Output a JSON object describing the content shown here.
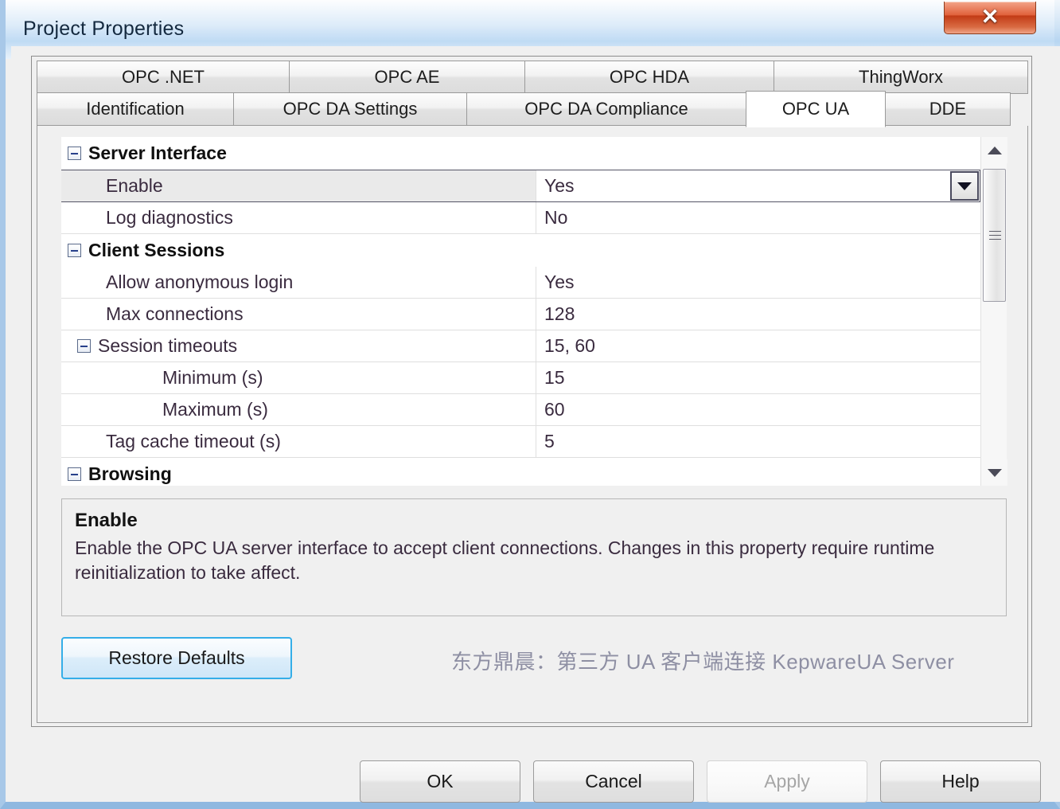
{
  "window": {
    "title": "Project Properties",
    "close_label": "✕"
  },
  "tabs": {
    "row1": [
      {
        "label": "OPC .NET",
        "selected": false
      },
      {
        "label": "OPC AE",
        "selected": false
      },
      {
        "label": "OPC HDA",
        "selected": false
      },
      {
        "label": "ThingWorx",
        "selected": false
      }
    ],
    "row2": [
      {
        "label": "Identification",
        "selected": false
      },
      {
        "label": "OPC DA Settings",
        "selected": false
      },
      {
        "label": "OPC DA Compliance",
        "selected": false
      },
      {
        "label": "OPC UA",
        "selected": true
      },
      {
        "label": "DDE",
        "selected": false
      }
    ]
  },
  "grid": {
    "rows": [
      {
        "kind": "category",
        "label": "Server Interface",
        "value": "",
        "expander": true
      },
      {
        "kind": "prop",
        "label": "Enable",
        "value": "Yes",
        "selected": true,
        "dropdown": true
      },
      {
        "kind": "prop",
        "label": "Log diagnostics",
        "value": "No"
      },
      {
        "kind": "category",
        "label": "Client Sessions",
        "value": "",
        "expander": true
      },
      {
        "kind": "prop",
        "label": "Allow anonymous login",
        "value": "Yes"
      },
      {
        "kind": "prop",
        "label": "Max connections",
        "value": "128"
      },
      {
        "kind": "prop",
        "label": "Session timeouts",
        "value": "15, 60",
        "expander": true
      },
      {
        "kind": "prop",
        "label": "Minimum (s)",
        "value": "15",
        "indent": 2
      },
      {
        "kind": "prop",
        "label": "Maximum (s)",
        "value": "60",
        "indent": 2
      },
      {
        "kind": "prop",
        "label": "Tag cache timeout (s)",
        "value": "5"
      },
      {
        "kind": "category",
        "label": "Browsing",
        "value": "",
        "expander": true
      }
    ]
  },
  "description": {
    "title": "Enable",
    "body": "Enable the OPC UA server interface to accept client connections.  Changes in this property require runtime reinitialization to take affect."
  },
  "restore": {
    "label": "Restore Defaults"
  },
  "watermark": {
    "text": "东方鼎晨：第三方 UA 客户端连接 KepwareUA Server"
  },
  "buttons": {
    "ok": "OK",
    "cancel": "Cancel",
    "apply": "Apply",
    "help": "Help"
  },
  "colors": {
    "accent": "#35aee8",
    "frame": "#a8c8e8",
    "close": "#c23b16",
    "label_text": "#3a2b3f"
  }
}
